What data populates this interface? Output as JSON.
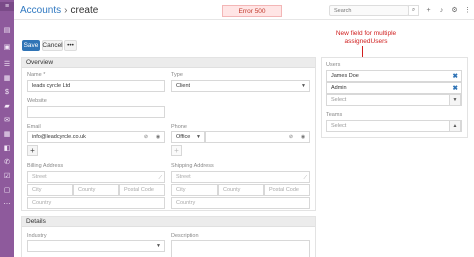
{
  "sidebar": {
    "items": [
      {
        "icon": "menu-icon",
        "glyph": "≡"
      },
      {
        "icon": "home-icon",
        "glyph": "▤"
      },
      {
        "icon": "accounts-icon",
        "glyph": "▣"
      },
      {
        "icon": "contacts-icon",
        "glyph": "☰"
      },
      {
        "icon": "leads-icon",
        "glyph": "▦"
      },
      {
        "icon": "opportunities-icon",
        "glyph": "$"
      },
      {
        "icon": "cases-icon",
        "glyph": "▰"
      },
      {
        "icon": "email-icon",
        "glyph": "✉"
      },
      {
        "icon": "calendar-icon",
        "glyph": "▦"
      },
      {
        "icon": "meetings-icon",
        "glyph": "◧"
      },
      {
        "icon": "calls-icon",
        "glyph": "✆"
      },
      {
        "icon": "tasks-icon",
        "glyph": "☑"
      },
      {
        "icon": "documents-icon",
        "glyph": "▢"
      },
      {
        "icon": "more-icon",
        "glyph": "⋯"
      }
    ]
  },
  "header": {
    "breadcrumb_root": "Accounts",
    "breadcrumb_sep": "›",
    "breadcrumb_current": "create",
    "error_badge": "Error 500",
    "search_placeholder": "Search",
    "search_icon": "search-icon",
    "icons": [
      "plus-icon",
      "bell-icon",
      "gear-icon",
      "menu-icon"
    ]
  },
  "toolbar": {
    "save_label": "Save",
    "cancel_label": "Cancel",
    "more_label": "•••"
  },
  "overview": {
    "title": "Overview",
    "name_label": "Name *",
    "name_value": "leads cyrcle Ltd",
    "type_label": "Type",
    "type_value": "Client",
    "website_label": "Website",
    "website_value": "",
    "email_label": "Email",
    "email_value": "info@leadcyrcle.co.uk",
    "phone_label": "Phone",
    "phone_type": "Office",
    "phone_value": "",
    "add_symbol": "+",
    "billing_label": "Billing Address",
    "shipping_label": "Shipping Address",
    "street_placeholder": "Street",
    "city_placeholder": "City",
    "county_placeholder": "County",
    "postal_placeholder": "Postal Code",
    "country_placeholder": "Country"
  },
  "details": {
    "title": "Details",
    "industry_label": "Industry",
    "industry_value": "",
    "description_label": "Description"
  },
  "side": {
    "annotation": "New field for multiple assignedUsers",
    "users_label": "Users",
    "users": [
      "James Doe",
      "Admin"
    ],
    "remove_symbol": "✖",
    "select_placeholder": "Select",
    "teams_label": "Teams"
  },
  "colors": {
    "sidebar": "#8e5a9c",
    "primary": "#3074b6",
    "link": "#3079c1",
    "annotation": "#d02020",
    "error_bg": "#ffe5e5"
  }
}
